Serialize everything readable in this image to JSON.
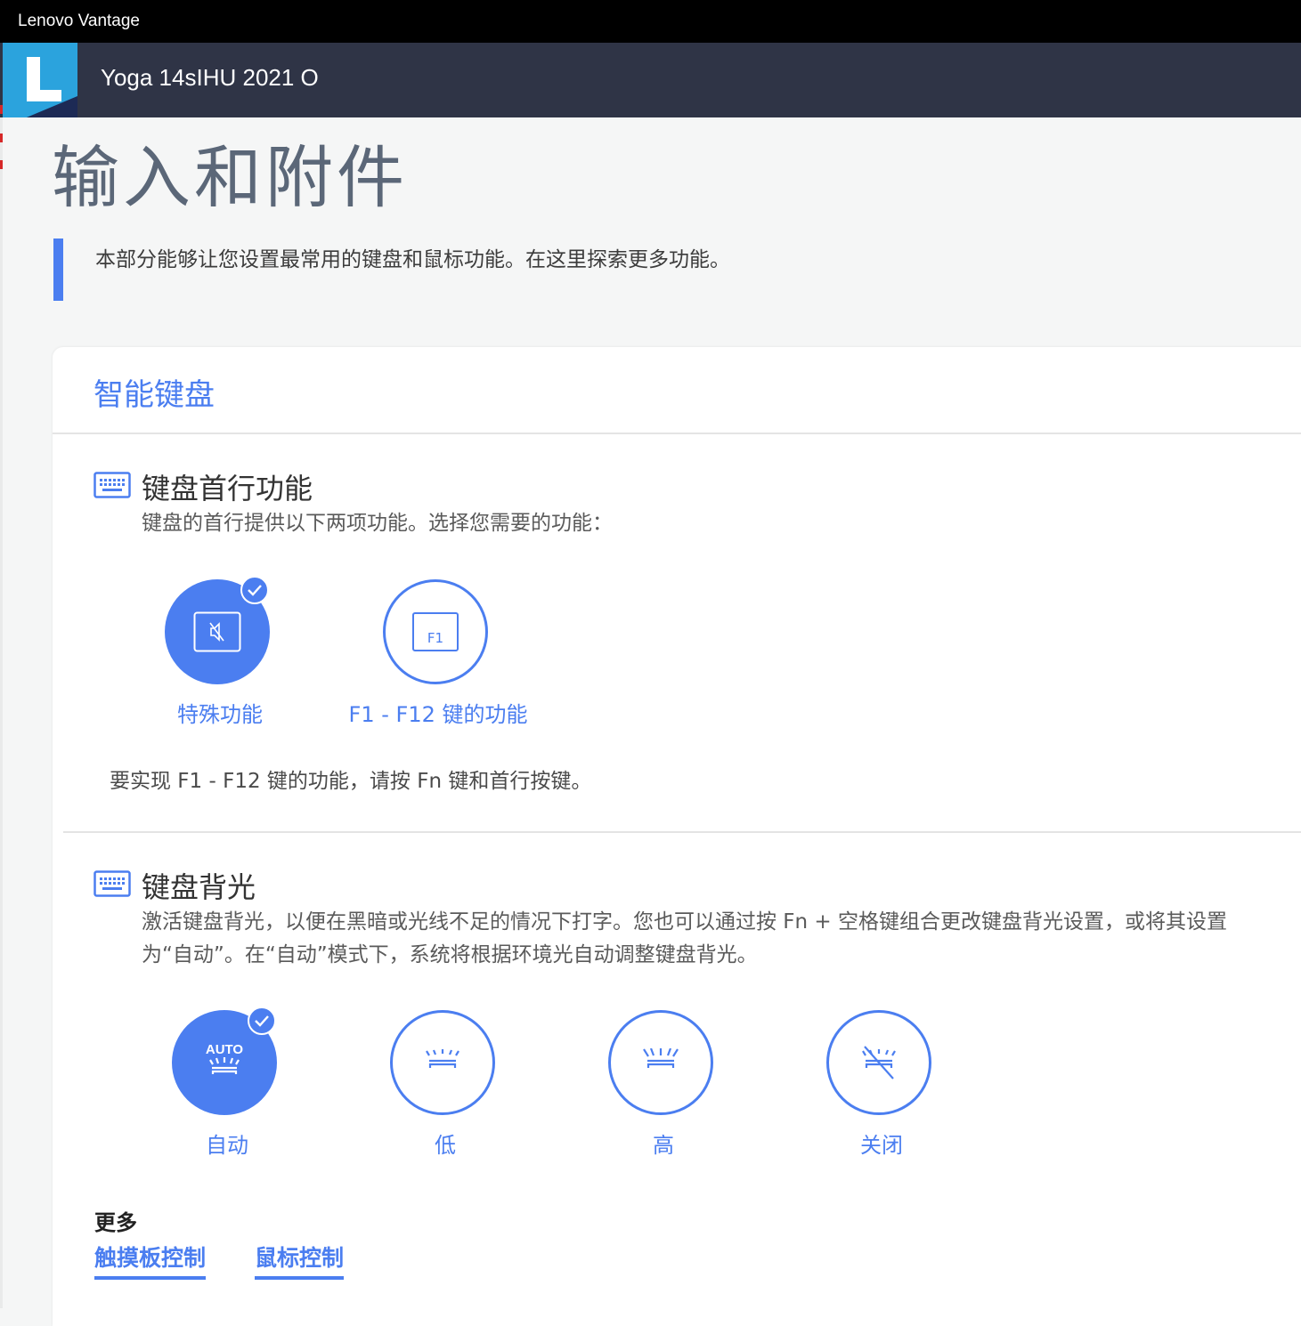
{
  "window": {
    "title": "Lenovo Vantage"
  },
  "header": {
    "device_name": "Yoga 14sIHU 2021 O"
  },
  "page": {
    "title": "输入和附件",
    "intro": "本部分能够让您设置最常用的键盘和鼠标功能。在这里探索更多功能。"
  },
  "card": {
    "title": "智能键盘",
    "hotkeys": {
      "title": "键盘首行功能",
      "description": "键盘的首行提供以下两项功能。选择您需要的功能：",
      "options": [
        {
          "label": "特殊功能",
          "icon": "mute-key-icon",
          "selected": true
        },
        {
          "label": "F1 - F12 键的功能",
          "icon": "f1-key-icon",
          "key_text": "F1",
          "selected": false
        }
      ],
      "note": "要实现 F1 - F12 键的功能，请按 Fn 键和首行按键。"
    },
    "backlight": {
      "title": "键盘背光",
      "description": "激活键盘背光，以便在黑暗或光线不足的情况下打字。您也可以通过按 Fn + 空格键组合更改键盘背光设置，或将其设置为“自动”。在“自动”模式下，系统将根据环境光自动调整键盘背光。",
      "options": [
        {
          "label": "自动",
          "icon": "backlight-auto-icon",
          "icon_text": "AUTO",
          "selected": true
        },
        {
          "label": "低",
          "icon": "backlight-low-icon",
          "selected": false
        },
        {
          "label": "高",
          "icon": "backlight-high-icon",
          "selected": false
        },
        {
          "label": "关闭",
          "icon": "backlight-off-icon",
          "selected": false
        }
      ]
    },
    "more": {
      "title": "更多",
      "links": [
        {
          "label": "触摸板控制"
        },
        {
          "label": "鼠标控制"
        }
      ]
    }
  },
  "colors": {
    "accent": "#4b7ef0",
    "appbar": "#2f3446",
    "logo": "#2ba3dd",
    "titlebar": "#000000"
  }
}
